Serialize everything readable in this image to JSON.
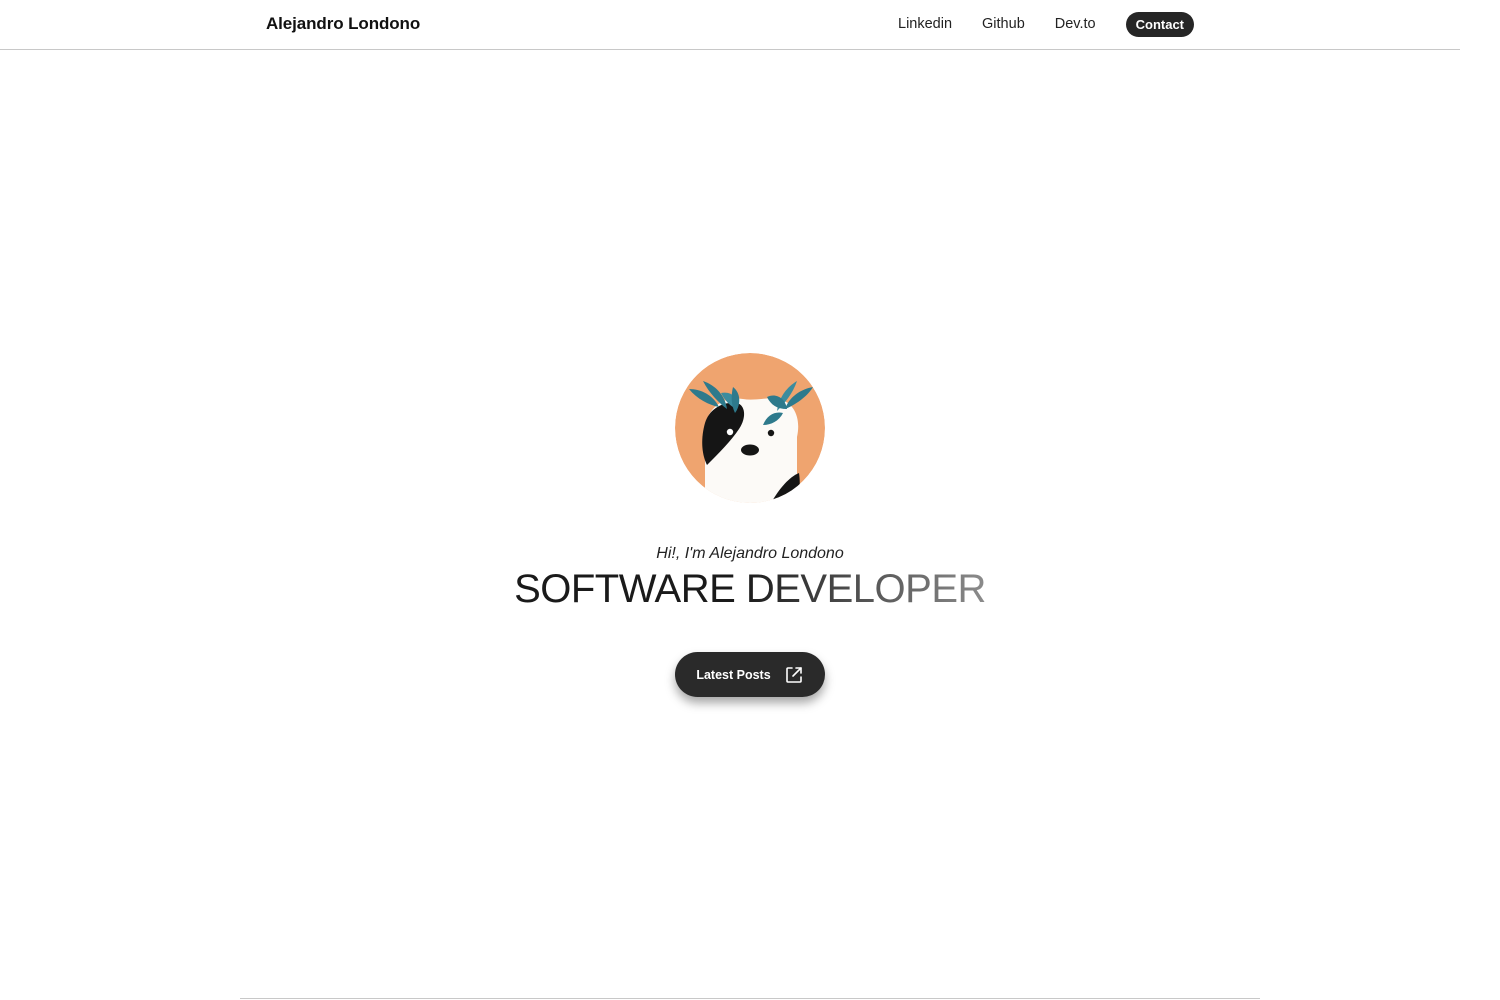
{
  "header": {
    "brand": "Alejandro Londono",
    "nav": {
      "linkedin": "Linkedin",
      "github": "Github",
      "devto": "Dev.to",
      "contact": "Contact"
    }
  },
  "hero": {
    "avatar_icon": "panda-avatar-icon",
    "greeting": "Hi!, I'm Alejandro Londono",
    "headline": "SOFTWARE DEVELOPER",
    "cta_label": "Latest Posts",
    "cta_icon": "external-link-icon"
  },
  "colors": {
    "avatar_background": "#EFA46F",
    "avatar_leaves": "#2E7A8C",
    "button_dark": "#2A2A2A",
    "divider": "#C8C8C8"
  }
}
